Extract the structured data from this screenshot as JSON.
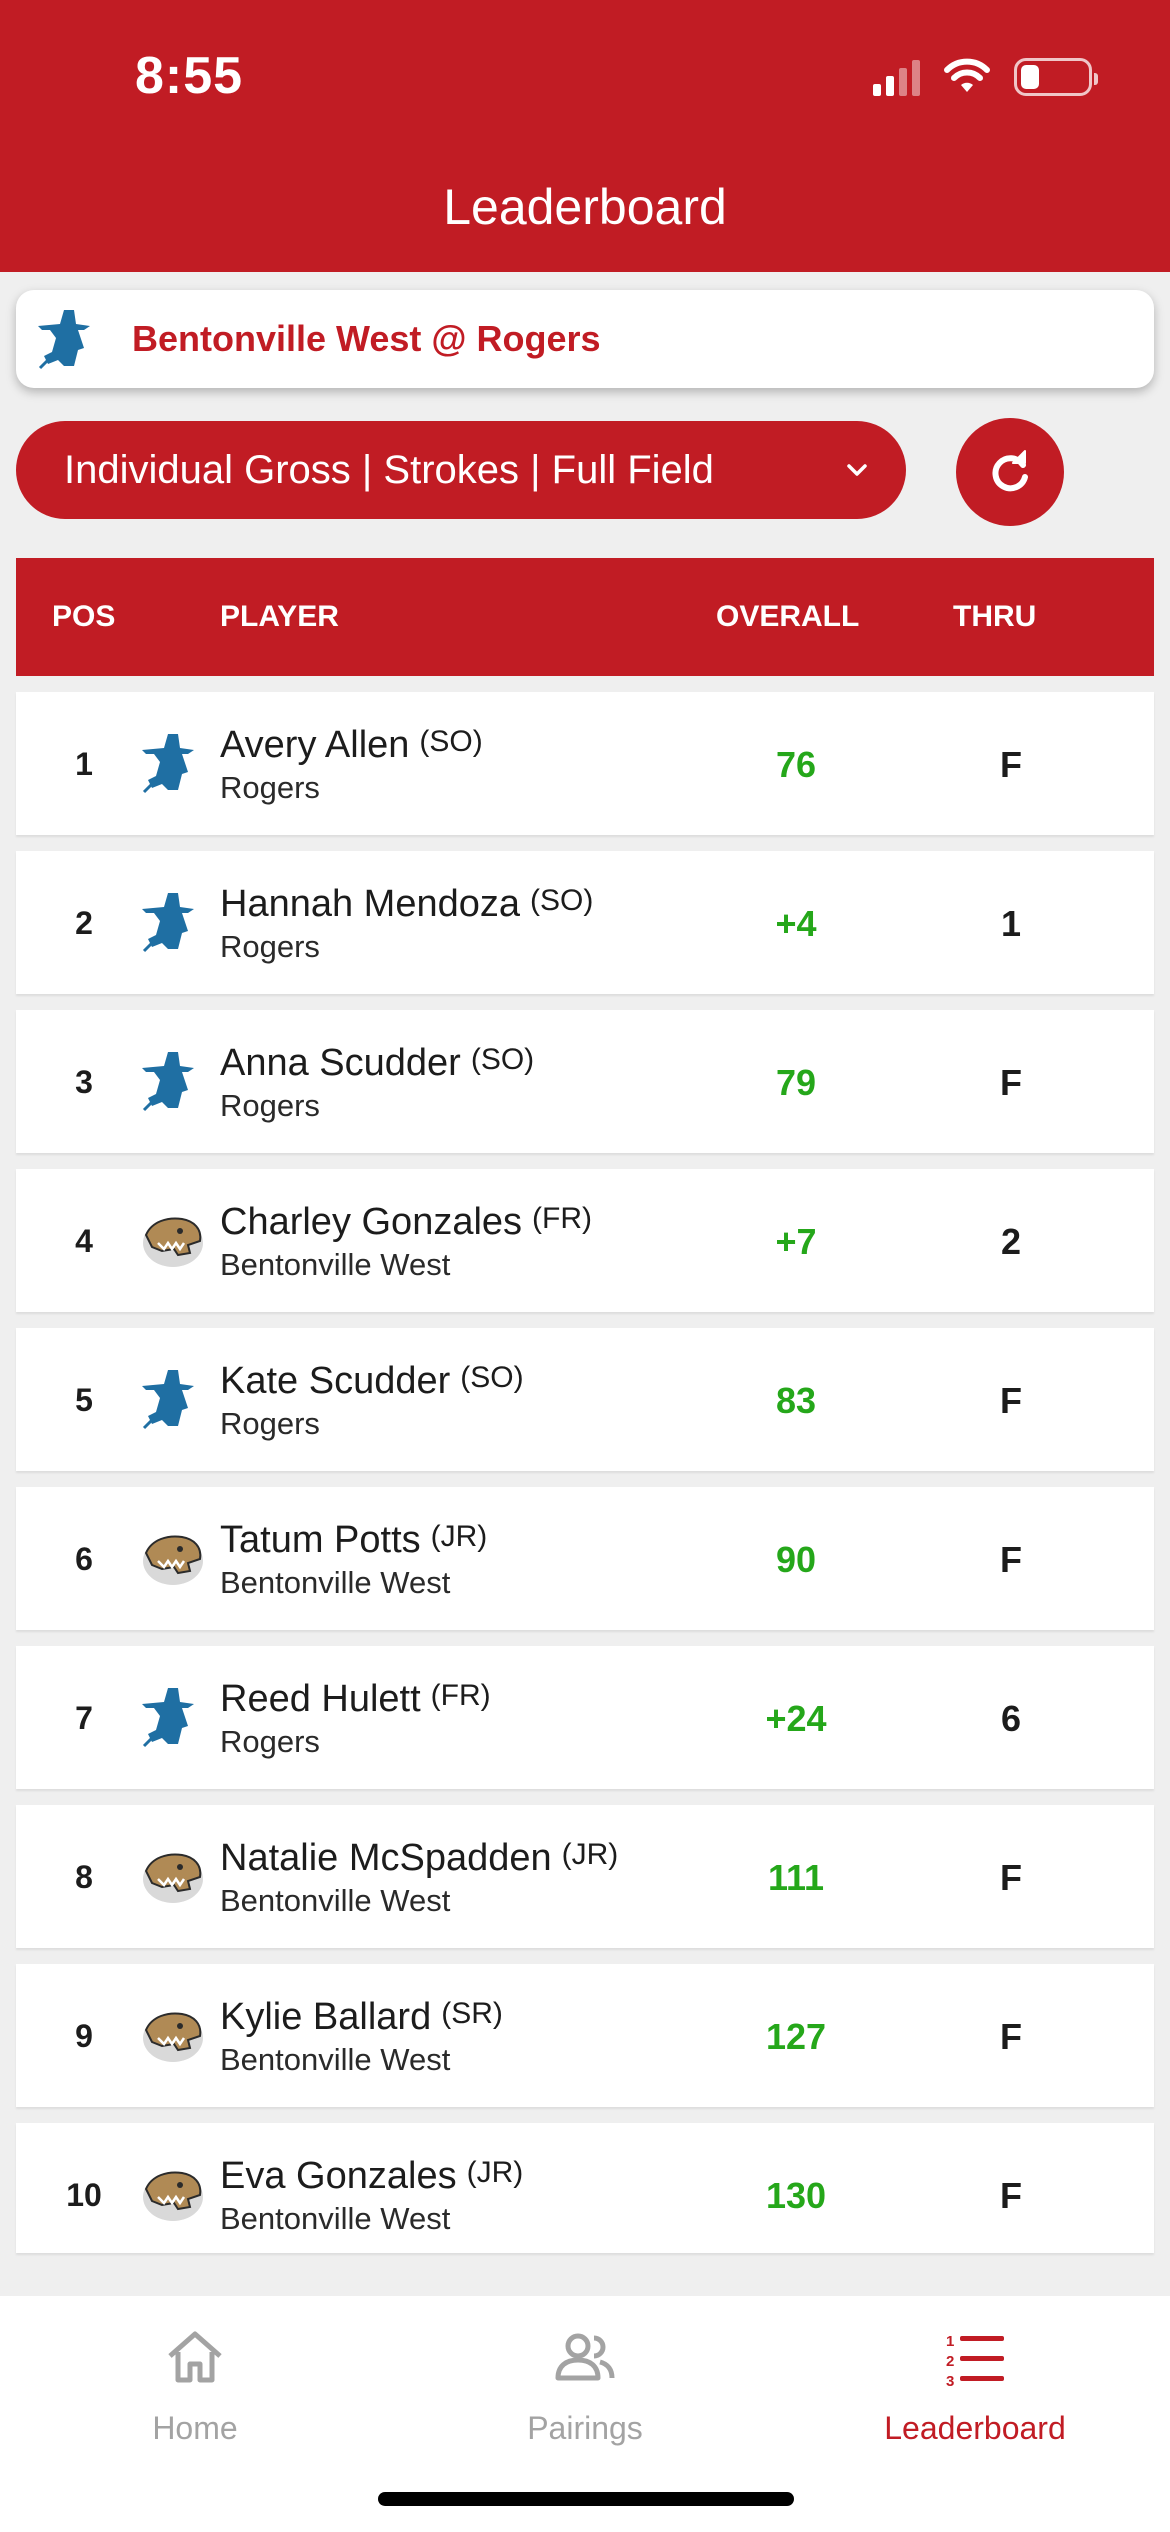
{
  "status_bar": {
    "time": "8:55"
  },
  "header": {
    "title": "Leaderboard"
  },
  "match": {
    "title": "Bentonville West @ Rogers"
  },
  "filter": {
    "selected": "Individual Gross | Strokes | Full Field"
  },
  "table": {
    "headers": {
      "pos": "POS",
      "player": "PLAYER",
      "overall": "OVERALL",
      "thru": "THRU"
    },
    "rows": [
      {
        "pos": "1",
        "name": "Avery Allen",
        "class": "(SO)",
        "team": "Rogers",
        "overall": "76",
        "thru": "F",
        "logo": "rogers"
      },
      {
        "pos": "2",
        "name": "Hannah Mendoza",
        "class": "(SO)",
        "team": "Rogers",
        "overall": "+4",
        "thru": "1",
        "logo": "rogers"
      },
      {
        "pos": "3",
        "name": "Anna Scudder",
        "class": "(SO)",
        "team": "Rogers",
        "overall": "79",
        "thru": "F",
        "logo": "rogers"
      },
      {
        "pos": "4",
        "name": "Charley Gonzales",
        "class": "(FR)",
        "team": "Bentonville West",
        "overall": "+7",
        "thru": "2",
        "logo": "bentonville-west"
      },
      {
        "pos": "5",
        "name": "Kate Scudder",
        "class": "(SO)",
        "team": "Rogers",
        "overall": "83",
        "thru": "F",
        "logo": "rogers"
      },
      {
        "pos": "6",
        "name": "Tatum Potts",
        "class": "(JR)",
        "team": "Bentonville West",
        "overall": "90",
        "thru": "F",
        "logo": "bentonville-west"
      },
      {
        "pos": "7",
        "name": "Reed Hulett",
        "class": "(FR)",
        "team": "Rogers",
        "overall": "+24",
        "thru": "6",
        "logo": "rogers"
      },
      {
        "pos": "8",
        "name": "Natalie McSpadden",
        "class": "(JR)",
        "team": "Bentonville West",
        "overall": "111",
        "thru": "F",
        "logo": "bentonville-west"
      },
      {
        "pos": "9",
        "name": "Kylie Ballard",
        "class": "(SR)",
        "team": "Bentonville West",
        "overall": "127",
        "thru": "F",
        "logo": "bentonville-west"
      },
      {
        "pos": "10",
        "name": "Eva Gonzales",
        "class": "(JR)",
        "team": "Bentonville West",
        "overall": "130",
        "thru": "F",
        "logo": "bentonville-west"
      }
    ]
  },
  "tabbar": {
    "home": "Home",
    "pairings": "Pairings",
    "leaderboard": "Leaderboard"
  },
  "colors": {
    "brand": "#c11c24",
    "score_green": "#25a71a",
    "inactive": "#a3a3a3"
  }
}
